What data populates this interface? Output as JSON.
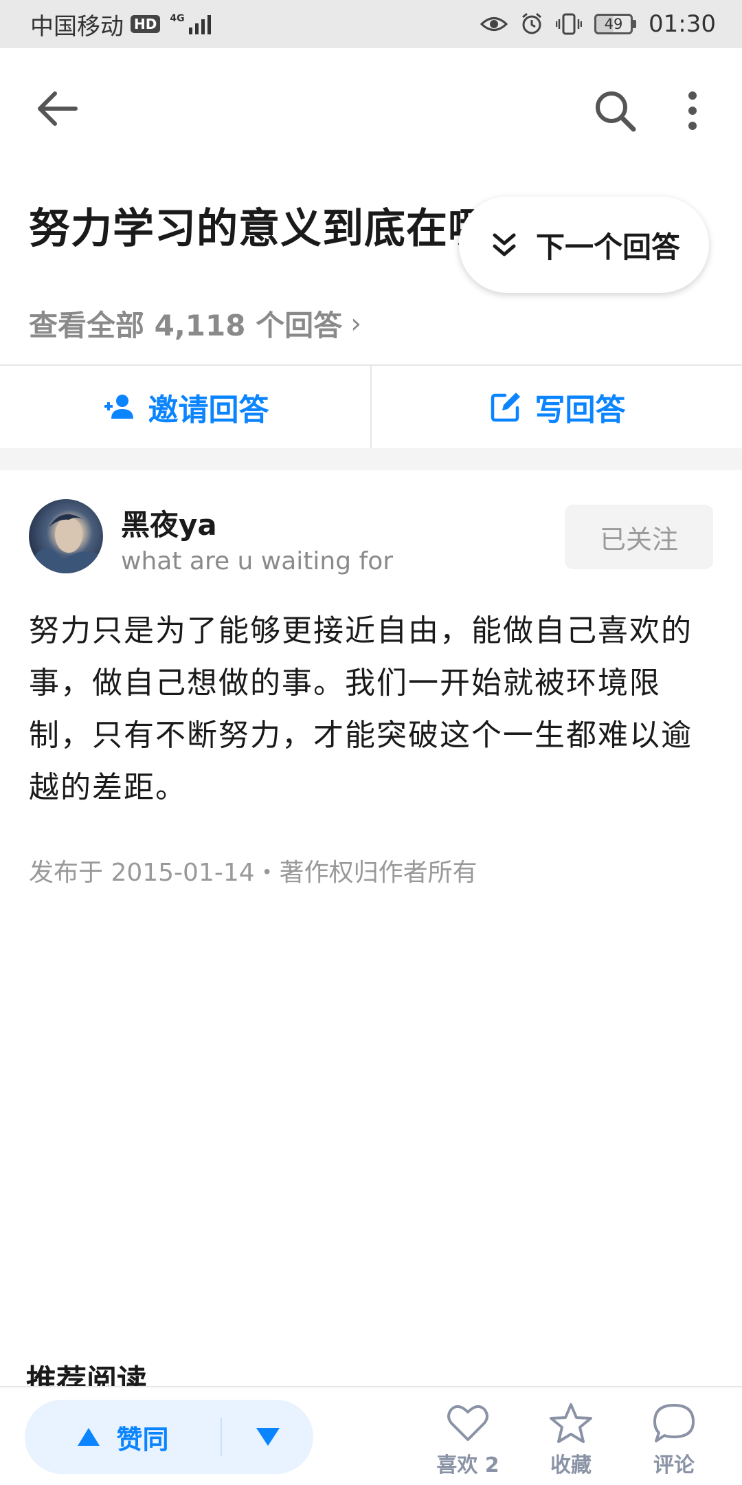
{
  "status_bar": {
    "carrier": "中国移动",
    "hd": "HD",
    "network": "4G",
    "battery": "49",
    "time": "01:30"
  },
  "question": {
    "title": "努力学习的意义到底在哪",
    "view_all": "查看全部 4,118 个回答"
  },
  "next_answer": {
    "label": "下一个回答"
  },
  "actions": {
    "invite_label": "邀请回答",
    "write_label": "写回答"
  },
  "answer": {
    "author_name": "黑夜ya",
    "author_bio": "what are u waiting for",
    "follow_label": "已关注",
    "content": "努力只是为了能够更接近自由，能做自己喜欢的事，做自己想做的事。我们一开始就被环境限制，只有不断努力，才能突破这个一生都难以逾越的差距。",
    "meta": "发布于 2015-01-14・著作权归作者所有"
  },
  "recommend_heading": "推荐阅读",
  "bottom_bar": {
    "upvote_label": "赞同",
    "like_label": "喜欢 2",
    "favorite_label": "收藏",
    "comment_label": "评论"
  },
  "colors": {
    "accent": "#0a84ff",
    "upvote_bg": "#e8f3ff",
    "muted": "#8a8a8a"
  }
}
